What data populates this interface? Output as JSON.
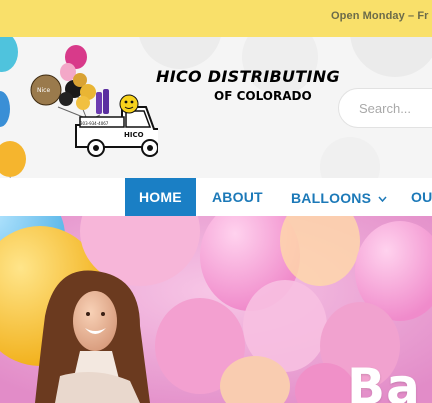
{
  "topbar": {
    "hours_text": "Open Monday – Fr"
  },
  "header": {
    "brand_line1": "HICO DISTRIBUTING",
    "brand_line2": "OF COLORADO",
    "truck_sign": "HICO",
    "truck_phone": "303-934-4067"
  },
  "search": {
    "placeholder": "Search..."
  },
  "nav": {
    "items": [
      {
        "label": "HOME",
        "active": true
      },
      {
        "label": "ABOUT",
        "active": false
      },
      {
        "label": "BALLOONS",
        "active": false,
        "dropdown": true
      },
      {
        "label": "OU",
        "active": false
      }
    ],
    "caret": "▾"
  },
  "hero": {
    "title": "Ba"
  },
  "colors": {
    "topbar": "#f9e06a",
    "nav_active": "#1a7fc5",
    "nav_text": "#1c79b8",
    "hero_pink": "#f0a7d3"
  }
}
